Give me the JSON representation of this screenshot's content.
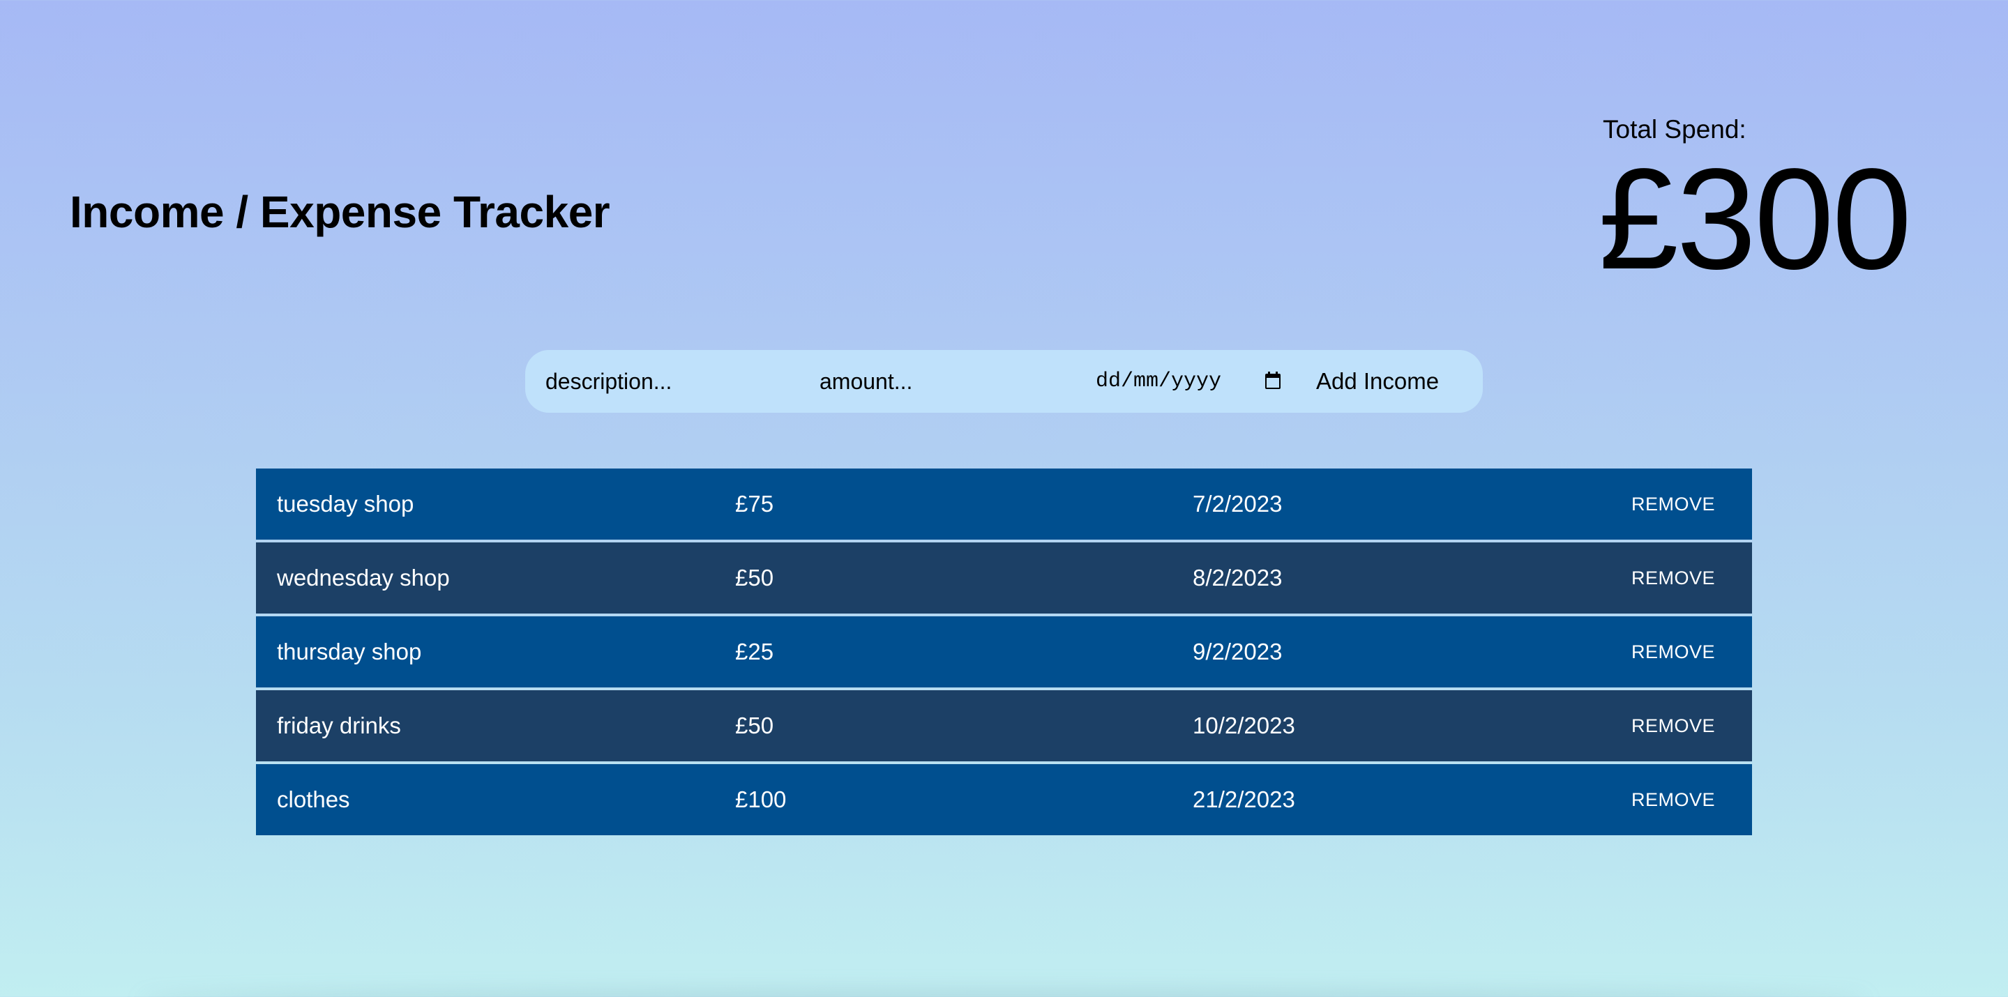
{
  "header": {
    "title": "Income / Expense Tracker",
    "total_label": "Total Spend:",
    "total_value": "£300"
  },
  "form": {
    "description_placeholder": "description...",
    "amount_placeholder": "amount...",
    "date_placeholder": "dd/mm/yyyy",
    "add_button_label": "Add Income"
  },
  "entries": [
    {
      "description": "tuesday shop",
      "amount": "£75",
      "date": "7/2/2023",
      "remove_label": "REMOVE"
    },
    {
      "description": "wednesday shop",
      "amount": "£50",
      "date": "8/2/2023",
      "remove_label": "REMOVE"
    },
    {
      "description": "thursday shop",
      "amount": "£25",
      "date": "9/2/2023",
      "remove_label": "REMOVE"
    },
    {
      "description": "friday drinks",
      "amount": "£50",
      "date": "10/2/2023",
      "remove_label": "REMOVE"
    },
    {
      "description": "clothes",
      "amount": "£100",
      "date": "21/2/2023",
      "remove_label": "REMOVE"
    }
  ],
  "icons": {
    "calendar": "calendar-icon"
  },
  "colors": {
    "row_light": "#004f8f",
    "row_dark": "#1c4066",
    "form_bg": "#bfe1fb",
    "bg_top": "#a6b9f5",
    "bg_bottom": "#c1eef1"
  }
}
